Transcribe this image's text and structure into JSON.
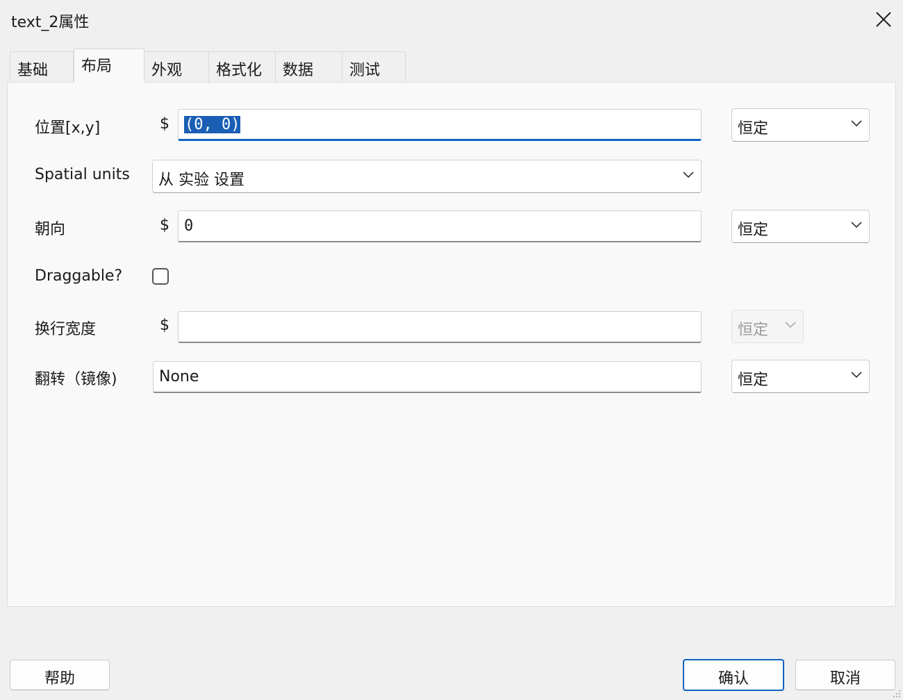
{
  "window": {
    "title": "text_2属性"
  },
  "tabs": [
    {
      "label": "基础"
    },
    {
      "label": "布局"
    },
    {
      "label": "外观"
    },
    {
      "label": "格式化"
    },
    {
      "label": "数据"
    },
    {
      "label": "测试"
    }
  ],
  "active_tab": "布局",
  "fields": {
    "position": {
      "label": "位置[x,y]",
      "prefix": "$",
      "value": "(0, 0)",
      "update_mode": "恒定"
    },
    "spatial_units": {
      "label": "Spatial units",
      "value": "从 实验 设置"
    },
    "orientation": {
      "label": "朝向",
      "prefix": "$",
      "value": "0",
      "update_mode": "恒定"
    },
    "draggable": {
      "label": "Draggable?",
      "checked": false
    },
    "wrap_width": {
      "label": "换行宽度",
      "prefix": "$",
      "value": "",
      "update_mode": "恒定"
    },
    "flip": {
      "label": "翻转（镜像)",
      "value": "None",
      "update_mode": "恒定"
    }
  },
  "buttons": {
    "help": "帮助",
    "ok": "确认",
    "cancel": "取消"
  },
  "colors": {
    "accent": "#1062c2",
    "selection": "#1a5fb4"
  }
}
